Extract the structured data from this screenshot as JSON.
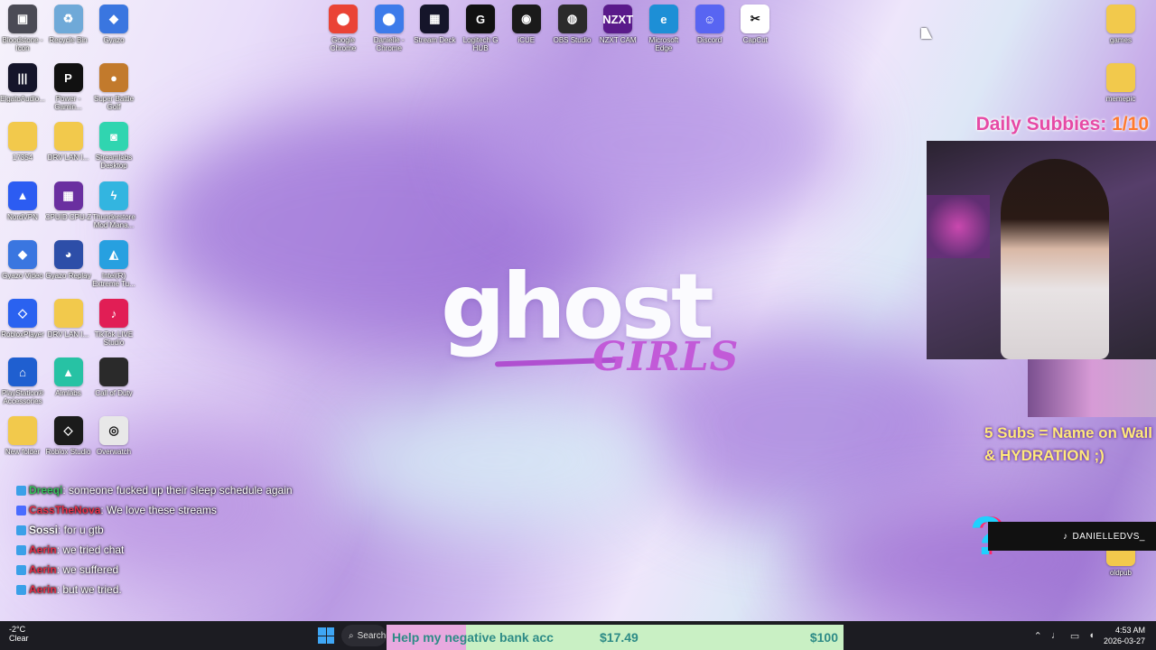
{
  "desktop": {
    "top_icons": [
      {
        "label": "Google Chrome",
        "icon": "chrome-icon",
        "glyph": "⬤",
        "color": "#ea4335"
      },
      {
        "label": "Danielle - Chrome",
        "icon": "chrome-profile-icon",
        "glyph": "⬤",
        "color": "#3d7bea"
      },
      {
        "label": "Stream Deck",
        "icon": "stream-deck-icon",
        "glyph": "▦",
        "color": "#15152a"
      },
      {
        "label": "Logitech G HUB",
        "icon": "logitech-g-icon",
        "glyph": "G",
        "color": "#111111"
      },
      {
        "label": "iCUE",
        "icon": "icue-icon",
        "glyph": "◉",
        "color": "#1a1a1a"
      },
      {
        "label": "OBS Studio",
        "icon": "obs-icon",
        "glyph": "◍",
        "color": "#2b2b2b"
      },
      {
        "label": "NZXT CAM",
        "icon": "nzxt-icon",
        "glyph": "NZXT",
        "color": "#5a1a8a"
      },
      {
        "label": "Microsoft Edge",
        "icon": "edge-icon",
        "glyph": "e",
        "color": "#1d8fd6"
      },
      {
        "label": "Discord",
        "icon": "discord-icon",
        "glyph": "☺",
        "color": "#5865f2"
      },
      {
        "label": "CapCut",
        "icon": "capcut-icon",
        "glyph": "✂",
        "color": "#ffffff"
      }
    ],
    "left_icons": [
      {
        "label": "Bloodstone - Icon",
        "icon": "bloodstone-icon",
        "glyph": "▣",
        "color": "#4b4b55"
      },
      {
        "label": "Recycle Bin",
        "icon": "recycle-bin-icon",
        "glyph": "♻",
        "color": "#6fa9d8"
      },
      {
        "label": "Gyazo",
        "icon": "gyazo-icon",
        "glyph": "◆",
        "color": "#3a76e0"
      },
      {
        "label": "ElgatoAudio...",
        "icon": "elgato-audio-icon",
        "glyph": "|||",
        "color": "#15152a"
      },
      {
        "label": "Power - Gamin...",
        "icon": "power-gaming-icon",
        "glyph": "P",
        "color": "#111111"
      },
      {
        "label": "Super Battle Golf",
        "icon": "golf-game-icon",
        "glyph": "●",
        "color": "#c27a2c"
      },
      {
        "label": "17354",
        "icon": "folder-icon",
        "glyph": "",
        "color": "#f2c94c"
      },
      {
        "label": "DRV LAN I...",
        "icon": "folder-icon",
        "glyph": "",
        "color": "#f2c94c"
      },
      {
        "label": "Streamlabs Desktop",
        "icon": "streamlabs-icon",
        "glyph": "◙",
        "color": "#30d5b0"
      },
      {
        "label": "NordVPN",
        "icon": "nordvpn-icon",
        "glyph": "▲",
        "color": "#2c5cf2"
      },
      {
        "label": "CPUID CPU-Z",
        "icon": "cpuz-icon",
        "glyph": "▦",
        "color": "#6a2fa0"
      },
      {
        "label": "Thunderstore Mod Mana...",
        "icon": "thunderstore-icon",
        "glyph": "ϟ",
        "color": "#33b5e0"
      },
      {
        "label": "Gyazo Video",
        "icon": "gyazo-video-icon",
        "glyph": "◆",
        "color": "#3a76e0"
      },
      {
        "label": "Gyazo Replay",
        "icon": "gyazo-replay-icon",
        "glyph": "◕",
        "color": "#2d4ea8"
      },
      {
        "label": "Intel(R) Extreme Tu...",
        "icon": "intel-tuning-icon",
        "glyph": "◭",
        "color": "#27a0e0"
      },
      {
        "label": "RobloxPlayer",
        "icon": "roblox-icon",
        "glyph": "◇",
        "color": "#2a62f0"
      },
      {
        "label": "DRV LAN I...",
        "icon": "folder-icon",
        "glyph": "",
        "color": "#f2c94c"
      },
      {
        "label": "TikTok LIVE Studio",
        "icon": "tiktok-live-icon",
        "glyph": "♪",
        "color": "#e11e55"
      },
      {
        "label": "PlayStation® Accessories",
        "icon": "playstation-icon",
        "glyph": "⌂",
        "color": "#1f5fd0"
      },
      {
        "label": "Aimlabs",
        "icon": "aimlabs-icon",
        "glyph": "▲",
        "color": "#27c2a4"
      },
      {
        "label": "Call of Duty",
        "icon": "cod-icon",
        "glyph": "",
        "color": "#2a2a2a"
      },
      {
        "label": "New folder",
        "icon": "folder-icon",
        "glyph": "",
        "color": "#f2c94c"
      },
      {
        "label": "Roblox Studio",
        "icon": "roblox-studio-icon",
        "glyph": "◇",
        "color": "#1b1b1b"
      },
      {
        "label": "Overwatch",
        "icon": "overwatch-icon",
        "glyph": "◎",
        "color": "#e8e8e8"
      }
    ],
    "right_icons": [
      {
        "label": "games",
        "icon": "games-folder-icon",
        "glyph": "",
        "color": "#f2c94c"
      },
      {
        "label": "memepic",
        "icon": "memepic-folder-icon",
        "glyph": "",
        "color": "#f2c94c"
      },
      {
        "label": "oldpub",
        "icon": "oldpub-folder-icon",
        "glyph": "",
        "color": "#f2c94c"
      }
    ]
  },
  "wallpaper": {
    "title": "ghost",
    "subtitle": "GIRLS"
  },
  "overlay": {
    "subs_label": "Daily Subbies:",
    "subs_count": "1/10",
    "goal_line1": "5 Subs = Name on Wall",
    "goal_line2": "& HYDRATION ;)",
    "tiktok_handle": "DANIELLEDVS_"
  },
  "chat": [
    {
      "user": "Dreeqi",
      "color": "#36c15a",
      "text": ": someone fucked up their sleep schedule again"
    },
    {
      "user": "CassTheNova",
      "color": "#e5304a",
      "text": ": We love these streams"
    },
    {
      "user": "Sossi",
      "color": "#ffffff",
      "text": ": for u gtb"
    },
    {
      "user": "Aerin",
      "color": "#e5304a",
      "text": ": we tried chat"
    },
    {
      "user": "Aerin",
      "color": "#e5304a",
      "text": ": we suffered"
    },
    {
      "user": "Aerin",
      "color": "#e5304a",
      "text": ": but we tried."
    }
  ],
  "taskbar": {
    "weather_temp": "-2°C",
    "weather_desc": "Clear",
    "search_label": "Search",
    "time": "4:53 AM",
    "date": "2026-03-27"
  },
  "donation": {
    "label": "Help my negative bank acc",
    "current": "$17.49",
    "goal": "$100",
    "progress": 0.1749
  }
}
